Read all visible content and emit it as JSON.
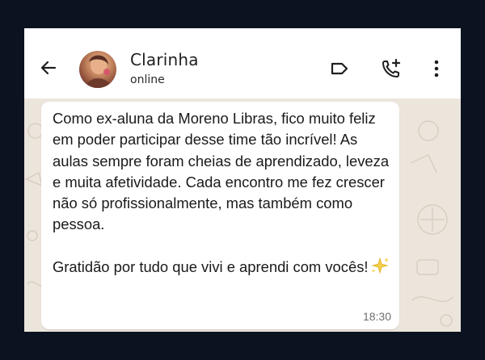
{
  "header": {
    "contact_name": "Clarinha",
    "status": "online",
    "icons": [
      "back-arrow-icon",
      "label-icon",
      "add-call-icon",
      "more-vert-icon"
    ]
  },
  "message": {
    "paragraph1": "Como ex-aluna da Moreno Libras, fico muito feliz em poder participar desse time tão incrível! As aulas sempre foram cheias de aprendizado, leveza e muita afetividade. Cada encontro me fez crescer não só profissionalmente, mas também como pessoa.",
    "paragraph2": "Gratidão por tudo que vivi e aprendi com vocês!",
    "emoji": "sparkles-icon",
    "time": "18:30"
  },
  "colors": {
    "page_background": "#0b1220",
    "chat_background": "#ece5dc",
    "bubble": "#ffffff",
    "text": "#1a1a1a"
  }
}
